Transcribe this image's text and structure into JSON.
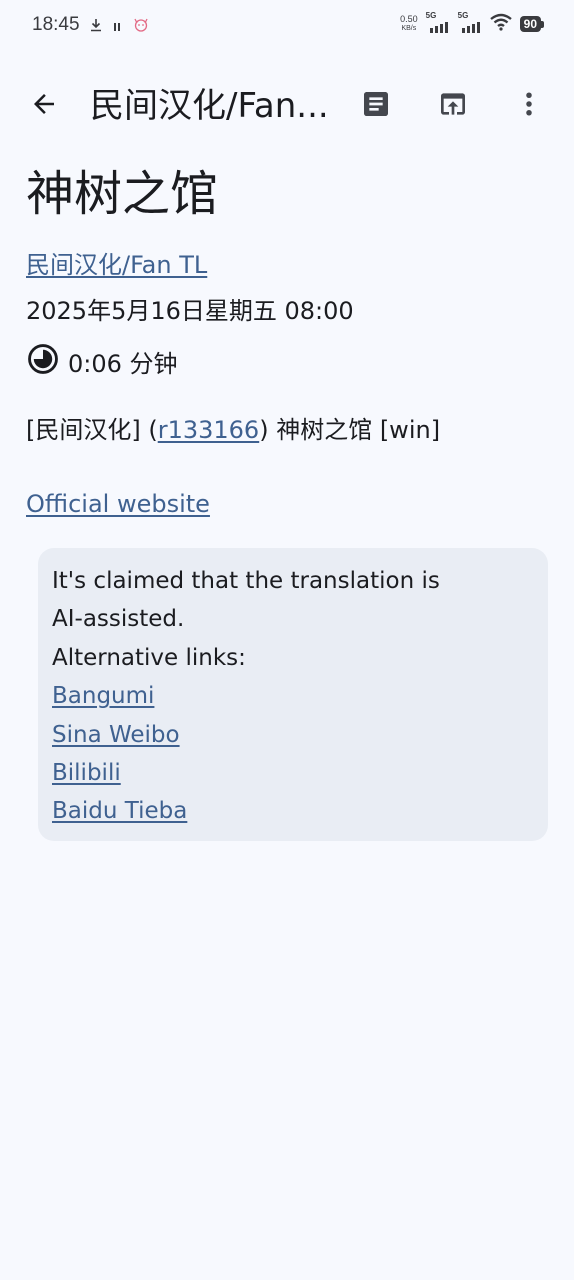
{
  "status_bar": {
    "time": "18:45",
    "net_speed_value": "0.50",
    "net_speed_unit": "KB/s",
    "signal1_label": "5G",
    "signal2_label": "5G",
    "battery": "90"
  },
  "app_bar": {
    "title": "民间汉化/Fan...",
    "icons": [
      "arrow-back-icon",
      "article-icon",
      "open-in-new-icon",
      "more-vert-icon"
    ]
  },
  "post": {
    "title": "神树之馆",
    "group_link": "民间汉化/Fan TL",
    "date": "2025年5月16日星期五 08:00",
    "duration": "0:06 分钟",
    "desc_prefix": "[民间汉化] (",
    "desc_link": "r133166",
    "desc_suffix": ") 神树之馆 [win]",
    "official_link": "Official website"
  },
  "note": {
    "line1": "It's claimed that the translation is",
    "line2": "AI-assisted.",
    "line3": "Alternative links:",
    "links": [
      "Bangumi",
      "Sina Weibo",
      "Bilibili",
      "Baidu Tieba"
    ]
  },
  "colors": {
    "background": "#f7f9fe",
    "link": "#3f6190",
    "note_bg": "#e9edf4"
  }
}
